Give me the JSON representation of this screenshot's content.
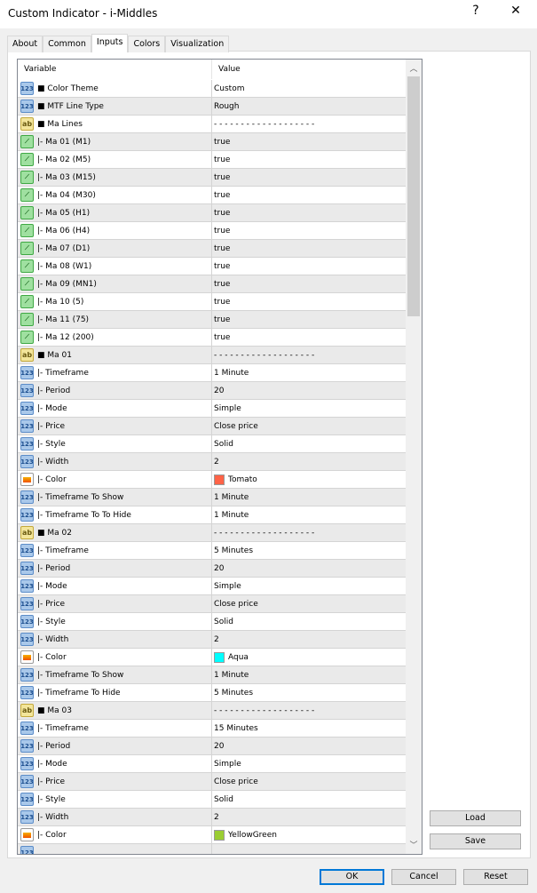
{
  "window": {
    "title": "Custom Indicator - i-Middles",
    "help_label": "?",
    "close_label": "✕"
  },
  "tabs": [
    {
      "label": "About"
    },
    {
      "label": "Common"
    },
    {
      "label": "Inputs",
      "active": true
    },
    {
      "label": "Colors"
    },
    {
      "label": "Visualization"
    }
  ],
  "table": {
    "headers": {
      "variable": "Variable",
      "value": "Value"
    },
    "rows": [
      {
        "icon": "123",
        "name": "■ Color Theme",
        "value": "Custom"
      },
      {
        "icon": "123",
        "name": "■ MTF Line Type",
        "value": "Rough"
      },
      {
        "icon": "ab",
        "name": "■ Ma Lines",
        "value": "- - - - - - - - - - - - - - - - - - -"
      },
      {
        "icon": "bool",
        "name": "|- Ma 01 (M1)",
        "value": "true"
      },
      {
        "icon": "bool",
        "name": "|- Ma 02 (M5)",
        "value": "true"
      },
      {
        "icon": "bool",
        "name": "|- Ma 03 (M15)",
        "value": "true"
      },
      {
        "icon": "bool",
        "name": "|- Ma 04 (M30)",
        "value": "true"
      },
      {
        "icon": "bool",
        "name": "|- Ma 05 (H1)",
        "value": "true"
      },
      {
        "icon": "bool",
        "name": "|- Ma 06 (H4)",
        "value": "true"
      },
      {
        "icon": "bool",
        "name": "|- Ma 07 (D1)",
        "value": "true"
      },
      {
        "icon": "bool",
        "name": "|- Ma 08 (W1)",
        "value": "true"
      },
      {
        "icon": "bool",
        "name": "|- Ma 09 (MN1)",
        "value": "true"
      },
      {
        "icon": "bool",
        "name": "|- Ma 10 (5)",
        "value": "true"
      },
      {
        "icon": "bool",
        "name": "|- Ma 11 (75)",
        "value": "true"
      },
      {
        "icon": "bool",
        "name": "|- Ma 12 (200)",
        "value": "true"
      },
      {
        "icon": "ab",
        "name": "■ Ma 01",
        "value": "- - - - - - - - - - - - - - - - - - -"
      },
      {
        "icon": "123",
        "name": "|- Timeframe",
        "value": "1 Minute"
      },
      {
        "icon": "123",
        "name": "|- Period",
        "value": "20"
      },
      {
        "icon": "123",
        "name": "|- Mode",
        "value": "Simple"
      },
      {
        "icon": "123",
        "name": "|- Price",
        "value": "Close price"
      },
      {
        "icon": "123",
        "name": "|- Style",
        "value": "Solid"
      },
      {
        "icon": "123",
        "name": "|- Width",
        "value": "2"
      },
      {
        "icon": "color",
        "name": "|- Color",
        "value": "Tomato",
        "swatch": "#ff6347"
      },
      {
        "icon": "123",
        "name": "|- Timeframe To Show",
        "value": "1 Minute"
      },
      {
        "icon": "123",
        "name": "|- Timeframe To To Hide",
        "value": "1 Minute"
      },
      {
        "icon": "ab",
        "name": "■ Ma 02",
        "value": "- - - - - - - - - - - - - - - - - - -"
      },
      {
        "icon": "123",
        "name": "|- Timeframe",
        "value": "5 Minutes"
      },
      {
        "icon": "123",
        "name": "|- Period",
        "value": "20"
      },
      {
        "icon": "123",
        "name": "|- Mode",
        "value": "Simple"
      },
      {
        "icon": "123",
        "name": "|- Price",
        "value": "Close price"
      },
      {
        "icon": "123",
        "name": "|- Style",
        "value": "Solid"
      },
      {
        "icon": "123",
        "name": "|- Width",
        "value": "2"
      },
      {
        "icon": "color",
        "name": "|- Color",
        "value": "Aqua",
        "swatch": "#00ffff"
      },
      {
        "icon": "123",
        "name": "|- Timeframe To Show",
        "value": "1 Minute"
      },
      {
        "icon": "123",
        "name": "|- Timeframe To Hide",
        "value": "5 Minutes"
      },
      {
        "icon": "ab",
        "name": "■ Ma 03",
        "value": "- - - - - - - - - - - - - - - - - - -"
      },
      {
        "icon": "123",
        "name": "|- Timeframe",
        "value": "15 Minutes"
      },
      {
        "icon": "123",
        "name": "|- Period",
        "value": "20"
      },
      {
        "icon": "123",
        "name": "|- Mode",
        "value": "Simple"
      },
      {
        "icon": "123",
        "name": "|- Price",
        "value": "Close price"
      },
      {
        "icon": "123",
        "name": "|- Style",
        "value": "Solid"
      },
      {
        "icon": "123",
        "name": "|- Width",
        "value": "2"
      },
      {
        "icon": "color",
        "name": "|- Color",
        "value": "YellowGreen",
        "swatch": "#9acd32"
      },
      {
        "icon": "123",
        "name": "",
        "value": ""
      }
    ]
  },
  "buttons": {
    "load": "Load",
    "save": "Save",
    "ok": "OK",
    "cancel": "Cancel",
    "reset": "Reset"
  },
  "icon_labels": {
    "num": "123",
    "str": "ab"
  }
}
